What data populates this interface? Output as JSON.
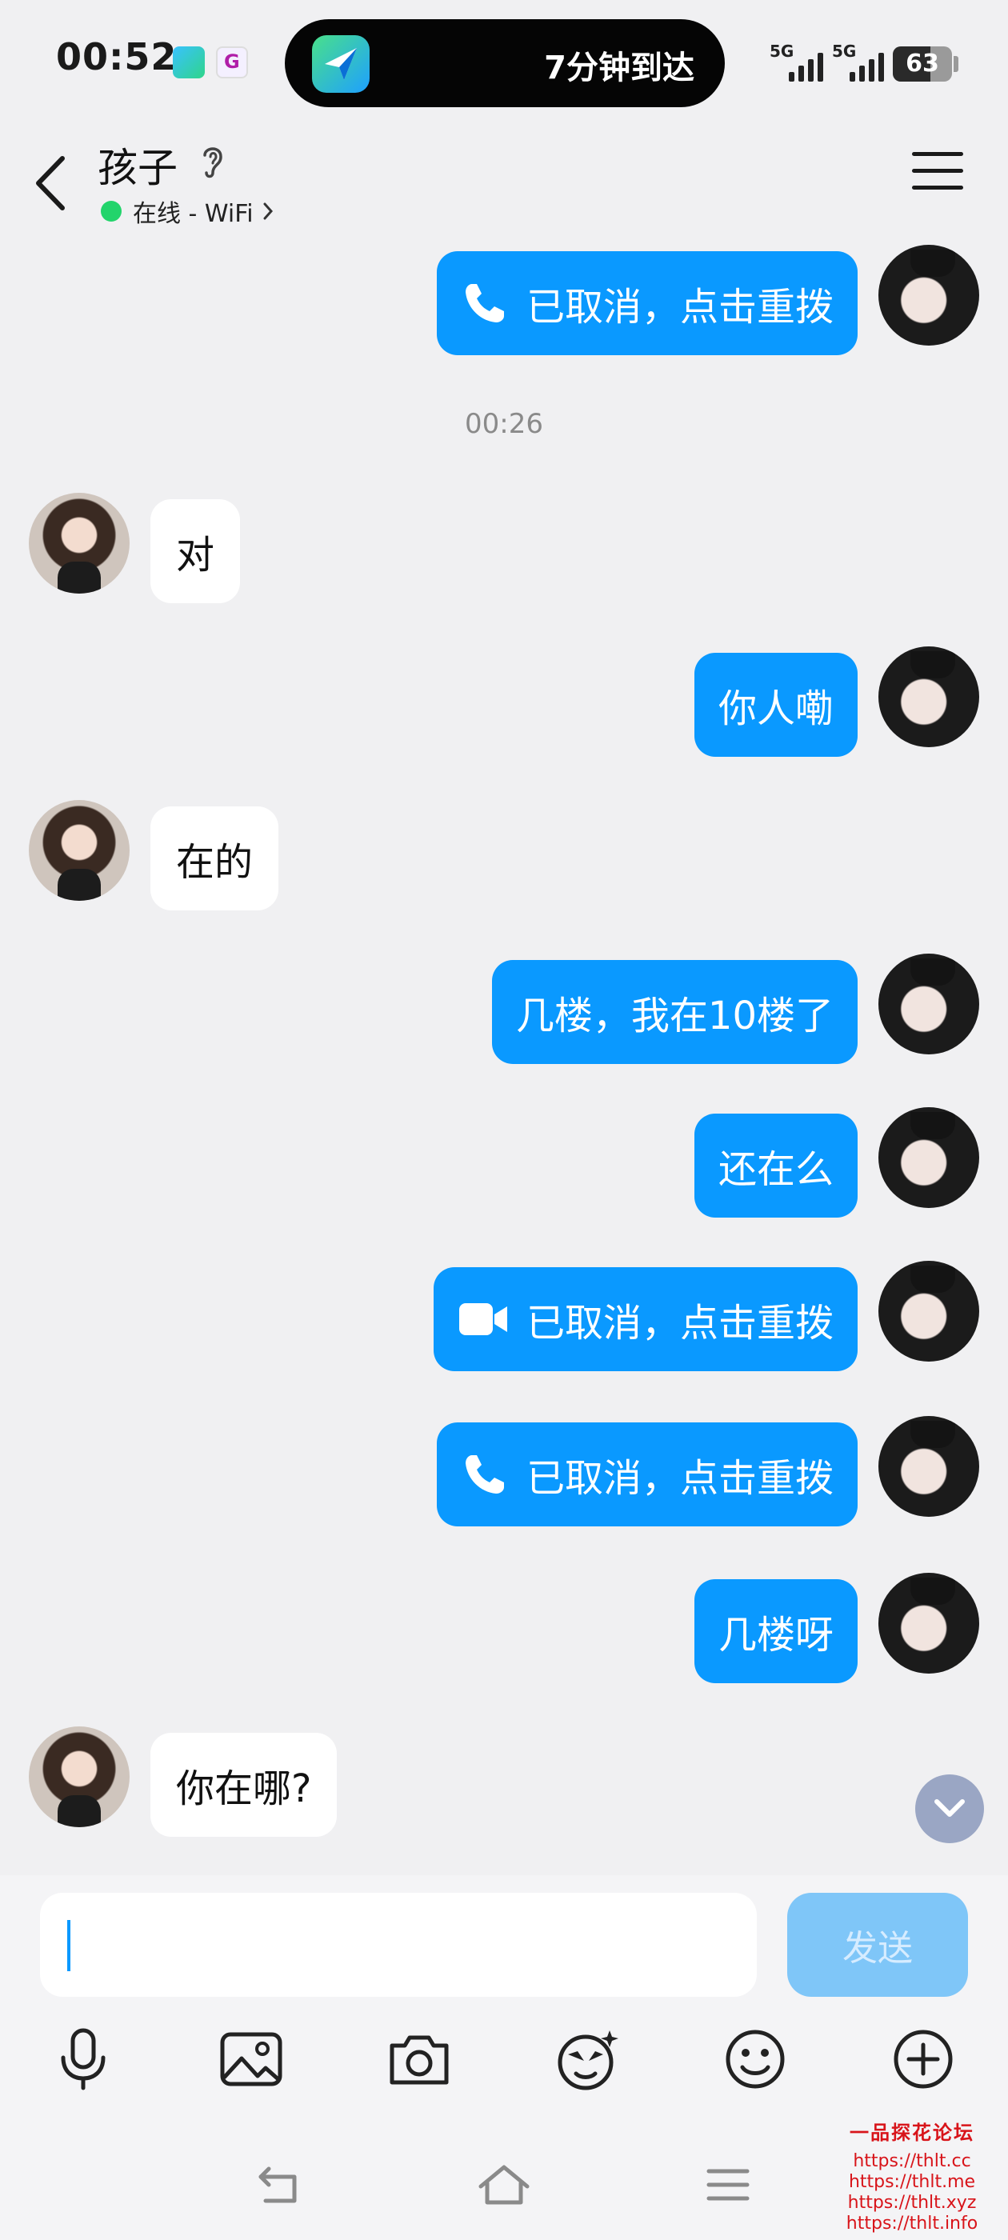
{
  "status_bar": {
    "time": "00:52",
    "island_text": "7分钟到达",
    "network_1": "5G",
    "network_2": "5G",
    "battery": "63"
  },
  "header": {
    "contact_name": "孩子",
    "presence": "在线 - WiFi"
  },
  "messages": [
    {
      "side": "out",
      "kind": "call",
      "icon": "phone-icon",
      "text": "已取消，点击重拨"
    },
    {
      "kind": "timestamp",
      "text": "00:26"
    },
    {
      "side": "in",
      "kind": "text",
      "text": "对"
    },
    {
      "side": "out",
      "kind": "text",
      "text": "你人嘞"
    },
    {
      "side": "in",
      "kind": "text",
      "text": "在的"
    },
    {
      "side": "out",
      "kind": "text",
      "text": "几楼，我在10楼了"
    },
    {
      "side": "out",
      "kind": "text",
      "text": "还在么"
    },
    {
      "side": "out",
      "kind": "call",
      "icon": "video-camera-icon",
      "text": "已取消，点击重拨"
    },
    {
      "side": "out",
      "kind": "call",
      "icon": "phone-icon",
      "text": "已取消，点击重拨"
    },
    {
      "side": "out",
      "kind": "text",
      "text": "几楼呀"
    },
    {
      "side": "in",
      "kind": "text",
      "text": "你在哪?"
    }
  ],
  "composer": {
    "input_value": "",
    "send_label": "发送",
    "tools": [
      "microphone-icon",
      "image-icon",
      "camera-icon",
      "sticker-icon",
      "emoji-icon",
      "plus-icon"
    ]
  },
  "watermark": {
    "title": "一品探花论坛",
    "links": [
      "https://thlt.cc",
      "https://thlt.me",
      "https://thlt.xyz",
      "https://thlt.info"
    ]
  },
  "colors": {
    "outgoing_bubble": "#0a99ff",
    "incoming_bubble": "#ffffff",
    "background": "#f0f0f2",
    "online_dot": "#22d46b",
    "send_button": "#7fc6f8"
  }
}
